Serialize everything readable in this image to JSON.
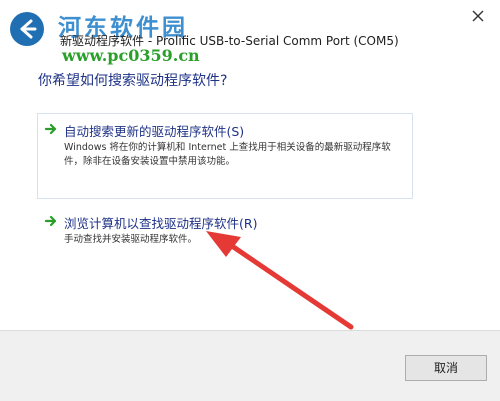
{
  "window": {
    "title": "新驱动程序软件 - Prolific USB-to-Serial Comm Port (COM5)"
  },
  "watermark": {
    "logo_text": "河东软件园",
    "site_url": "www.pc0359.cn"
  },
  "content": {
    "question": "你希望如何搜索驱动程序软件?",
    "options": [
      {
        "title": "自动搜索更新的驱动程序软件(S)",
        "description": "Windows 将在你的计算机和 Internet 上查找用于相关设备的最新驱动程序软件，除非在设备安装设置中禁用该功能。"
      },
      {
        "title": "浏览计算机以查找驱动程序软件(R)",
        "description": "手动查找并安装驱动程序软件。"
      }
    ]
  },
  "footer": {
    "cancel_label": "取消"
  },
  "colors": {
    "link_blue": "#1e3287",
    "arrow_green": "#2a9d2a",
    "annotation_red": "#e53935",
    "footer_bg": "#f0f0f0"
  },
  "icons": [
    "back-arrow-icon",
    "close-icon",
    "green-arrow-icon",
    "red-annotation-arrow"
  ]
}
